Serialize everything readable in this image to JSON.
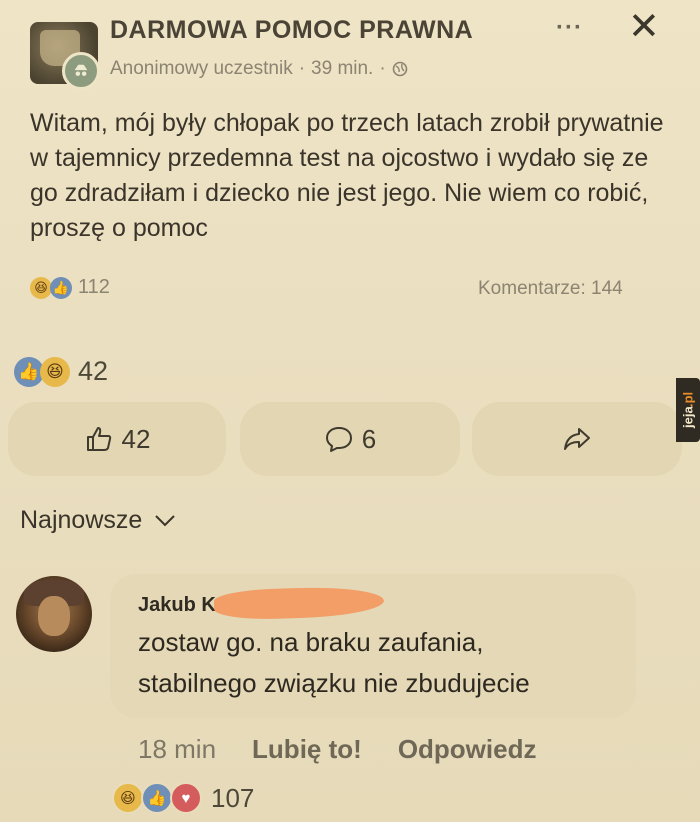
{
  "header": {
    "group_name": "DARMOWA POMOC PRAWNA",
    "author": "Anonimowy uczestnik",
    "separator": "·",
    "time": "39 min.",
    "dot_after_time": "·",
    "more_label": "···",
    "close_label": "✕"
  },
  "post": {
    "text": "Witam, mój były chłopak po trzech latach zrobił prywatnie w tajemnicy przedemna test na ojcostwo i wydało się ze go zdradziłam i dziecko nie jest jego. Nie wiem co robić, proszę o pomoc",
    "reaction_count": "112",
    "comments_label": "Komentarze: 144"
  },
  "reactions2": {
    "count": "42"
  },
  "actions": {
    "like_count": "42",
    "comment_count": "6"
  },
  "watermark": {
    "prefix": "jeja",
    "suffix": ".pl"
  },
  "sort": {
    "label": "Najnowsze"
  },
  "comment": {
    "author": "Jakub K",
    "text_line1": "zostaw go. na braku zaufania,",
    "text_line2": "stabilnego związku nie zbudujecie",
    "time": "18 min",
    "like_label": "Lubię to!",
    "reply_label": "Odpowiedz",
    "reaction_count": "107"
  },
  "colors": {
    "background": "#eadfc0",
    "bubble": "#e4d8b6",
    "redaction": "#f39a63"
  }
}
